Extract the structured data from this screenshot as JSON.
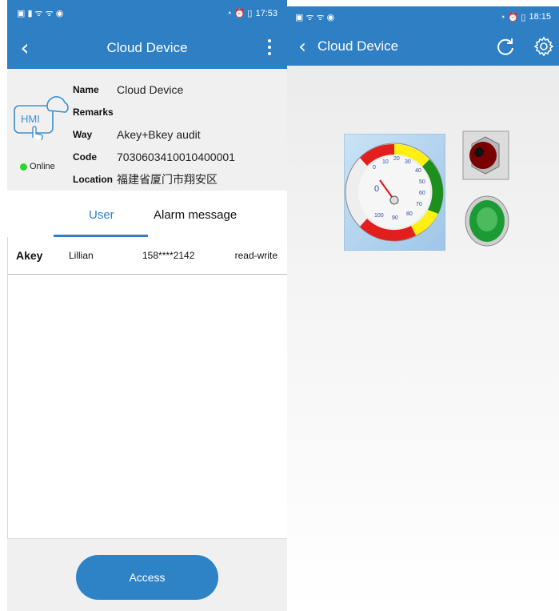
{
  "left": {
    "status": {
      "icons": "▣ ▮ ᯤ ᯤ ◉",
      "right_icons": "◔ ⏰ ▯",
      "time": "17:53"
    },
    "header": {
      "title": "Cloud Device"
    },
    "device": {
      "icon_text": "HMI",
      "status": "Online",
      "fields": [
        {
          "key": "Name",
          "value": "Cloud Device"
        },
        {
          "key": "Remarks",
          "value": ""
        },
        {
          "key": "Way",
          "value": "Akey+Bkey audit"
        },
        {
          "key": "Code",
          "value": "7030603410010400001"
        },
        {
          "key": "Location",
          "value": "福建省厦门市翔安区"
        }
      ]
    },
    "tabs": [
      {
        "label": "User"
      },
      {
        "label": "Alarm message"
      }
    ],
    "users": [
      {
        "type": "Akey",
        "name": "Lillian",
        "phone": "158****2142",
        "permission": "read-write"
      }
    ],
    "access_label": "Access"
  },
  "right": {
    "status": {
      "icons": "▣ ᯤ ᯤ ◉",
      "right_icons": "◔ ⏰ ▯",
      "time": "18:15"
    },
    "header": {
      "title": "Cloud Device"
    },
    "gauge": {
      "ticks": [
        "0",
        "10",
        "20",
        "30",
        "40",
        "50",
        "60",
        "70",
        "80",
        "90",
        "100"
      ],
      "value": 0
    }
  },
  "colors": {
    "primary": "#2e7fc4",
    "online": "#2bd62b"
  }
}
